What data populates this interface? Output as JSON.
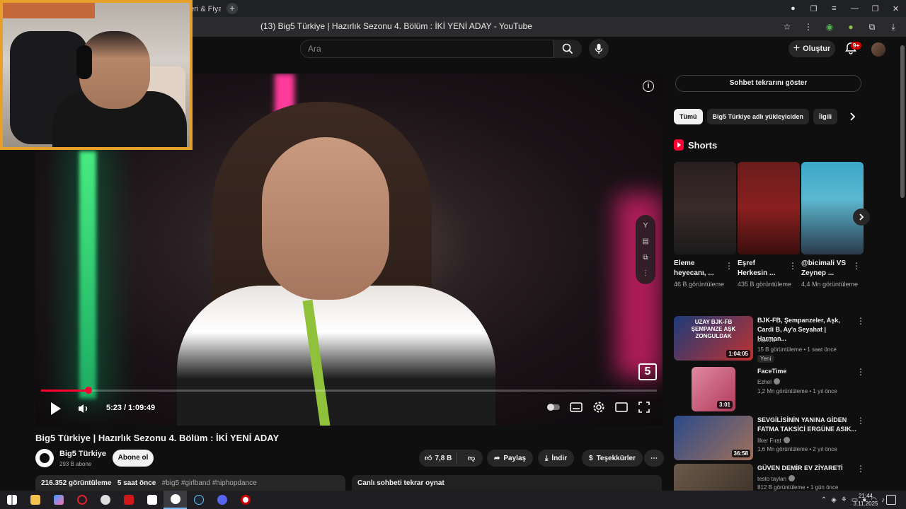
{
  "browser": {
    "tab_label": "eri & Fiyat",
    "new_tab": "+",
    "page_title": "(13) Big5 Türkiye | Hazırlık Sezonu 4. Bölüm : İKİ YENİ ADAY - YouTube"
  },
  "header": {
    "search_placeholder": "Ara",
    "create_label": "Oluştur",
    "notif_badge": "9+"
  },
  "player": {
    "current_time": "5:23",
    "duration": "1:09:49",
    "time_label": "5:23 / 1:09:49",
    "progress": 0.077,
    "channel_logo": "5"
  },
  "video": {
    "title": "Big5 Türkiye | Hazırlık Sezonu 4. Bölüm : İKİ YENİ ADAY",
    "channel_name": "Big5 Türkiye",
    "subscribers": "293 B abone",
    "subscribe_label": "Abone ol",
    "likes": "7,8 B",
    "share_label": "Paylaş",
    "download_label": "İndir",
    "thanks_label": "Teşekkürler",
    "views": "216.352 görüntüleme",
    "posted": "5 saat önce",
    "tags": "#big5 #girlband #hiphopdance",
    "replay_label": "Canlı sohbeti tekrar oynat"
  },
  "sidebar": {
    "chat_button": "Sohbet tekrarını göster",
    "chips": [
      "Tümü",
      "Big5 Türkiye adlı yükleyiciden",
      "İlgili"
    ],
    "shorts_heading": "Shorts",
    "shorts": [
      {
        "title": "Eleme heyecanı, ...",
        "views": "46 B görüntüleme",
        "color": "#3a2a2a"
      },
      {
        "title": "Eşref Herkesin ...",
        "views": "435 B görüntüleme",
        "color": "#5a1616"
      },
      {
        "title": "@bicimali VS Zeynep ...",
        "views": "4,4 Mn görüntüleme",
        "color": "#4a9fb8"
      }
    ],
    "videos": [
      {
        "title": "BJK-FB, Şempanzeler, Aşk, Cardi B, Ay'a Seyahat | Harman...",
        "channel": "Mantra",
        "meta": "15 B görüntüleme • 1 saat önce",
        "duration": "1:04:05",
        "badge": "Yeni",
        "thumb_text": "UZAY BJK-FB ŞEMPANZE AŞK ZONGULDAK",
        "color": "#1c3c7a"
      },
      {
        "title": "FaceTime",
        "channel": "Ezhel",
        "meta": "1,2 Mn görüntüleme • 1 yıl önce",
        "duration": "3:01",
        "color": "#c24a6a"
      },
      {
        "title": "SEVGİLİSİNİN YANINA GİDEN FATMA TAKSİCİ ERGÜNE ASIK...",
        "channel": "İlker Fırat",
        "meta": "1,6 Mn görüntüleme • 2 yıl önce",
        "duration": "36:58",
        "color": "#2c4a8a"
      },
      {
        "title": "GÜVEN DEMİR EV ZİYARETİ",
        "channel": "testo taylan",
        "meta": "812 B görüntüleme • 1 gün önce",
        "duration": "",
        "color": "#6a5a4a"
      }
    ]
  },
  "taskbar": {
    "time": "21:44",
    "date": "3.11.2025"
  },
  "colors": {
    "accent_red": "#ff0033",
    "webcam_border": "#e8a02a"
  }
}
